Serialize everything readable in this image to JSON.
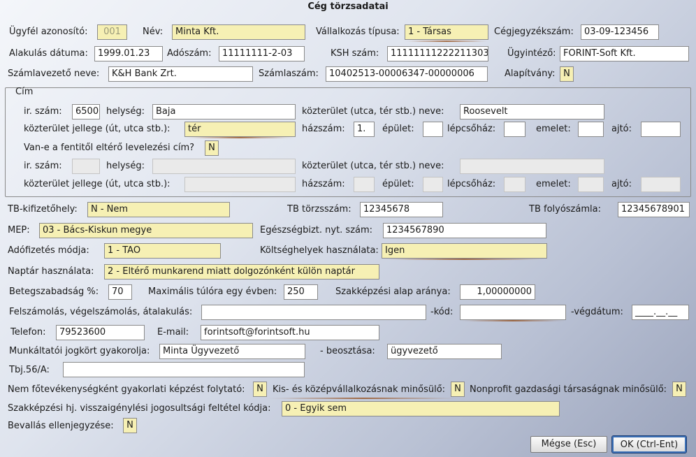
{
  "window": {
    "title": "Cég törzsadatai"
  },
  "labels": {
    "ugyfel_azonosito": "Ügyfél azonosító:",
    "nev": "Név:",
    "vallalkozas_tipusa": "Vállalkozás típusa:",
    "cegjegyzekszam": "Cégjegyzékszám:",
    "alakulas_datuma": "Alakulás dátuma:",
    "adoszam": "Adószám:",
    "ksh_szam": "KSH szám:",
    "ugyintezo": "Ügyintéző:",
    "szamlavezeto_neve": "Számlavezető neve:",
    "szamlaszam": "Számlaszám:",
    "alapitvany": "Alapítvány:",
    "cim_group": "Cím",
    "ir_szam": "ir. szám:",
    "helyseg": "helység:",
    "kozterulet_neve": "közterület (utca, tér stb.) neve:",
    "kozterulet_jellege": "közterület jellege (út, utca stb.):",
    "hazszam": "házszám:",
    "epulet": "épület:",
    "lepcsohaz": "lépcsőház:",
    "emelet": "emelet:",
    "ajto": "ajtó:",
    "elterő_levelezesi": "Van-e a fentitől eltérő levelezési cím?",
    "tb_kifizetohely": "TB-kifizetőhely:",
    "tb_torzsszam": "TB törzsszám:",
    "tb_folyoszamla": "TB folyószámla:",
    "mep": "MEP:",
    "egeszsegbizt": "Egészségbizt. nyt. szám:",
    "adofizetes_modja": "Adófizetés módja:",
    "koltseghelyek": "Költséghelyek használata:",
    "naptar": "Naptár használata:",
    "betegszabadsag": "Betegszabadság %:",
    "max_tulora": "Maximális túlóra egy évben:",
    "szakkepzesi_arany": "Szakképzési alap aránya:",
    "felszamolas": "Felszámolás, végelszámolás, átalakulás:",
    "kod": "-kód:",
    "vegdatum": "-végdátum:",
    "telefon": "Telefon:",
    "email": "E-mail:",
    "munkaltatoi": "Munkáltatói jogkört gyakorolja:",
    "beosztasa": "- beosztása:",
    "tbj56a": "Tbj.56/A:",
    "nem_fotev": "Nem főtevékenységként gyakorlati képzést folytató:",
    "kis_kozep": "Kis- és középvállalkozásnak minősülő:",
    "nonprofit": "Nonprofit gazdasági társaságnak minősülő:",
    "szakkepzesi_kod": "Szakképzési hj. visszaigénylési jogosultsági feltétel kódja:",
    "bevallas": "Bevallás ellenjegyzése:"
  },
  "values": {
    "ugyfel_azonosito": "001",
    "nev": "Minta Kft.",
    "vallalkozas_tipusa": "1 - Társas",
    "cegjegyzekszam": "03-09-123456",
    "alakulas_datuma": "1999.01.23",
    "adoszam": "11111111-2-03",
    "ksh_szam": "11111111222211303",
    "ugyintezo": "FORINT-Soft Kft.",
    "szamlavezeto_neve": "K&H Bank Zrt.",
    "szamlaszam": "10402513-00006347-00000006",
    "alapitvany": "N",
    "ir_szam": "6500",
    "helyseg": "Baja",
    "kozterulet_neve": "Roosevelt",
    "kozterulet_jellege": "tér",
    "hazszam": "1.",
    "epulet": "",
    "lepcsohaz": "",
    "emelet": "",
    "ajto": "",
    "elterő_levelezesi": "N",
    "tb_kifizetohely": "N - Nem",
    "tb_torzsszam": "12345678",
    "tb_folyoszamla": "12345678901",
    "mep": "03 - Bács-Kiskun megye",
    "egeszsegbizt": "1234567890",
    "adofizetes_modja": "1 - TAO",
    "koltseghelyek": "Igen",
    "naptar": "2 - Eltérő munkarend miatt dolgozónként külön naptár",
    "betegszabadsag": "70",
    "max_tulora": "250",
    "szakkepzesi_arany": "1,00000000",
    "felszamolas": "",
    "kod": "",
    "vegdatum": "____.__.__",
    "telefon": "79523600",
    "email": "forintsoft@forintsoft.hu",
    "munkaltatoi": "Minta Ügyvezető",
    "beosztasa": "ügyvezető",
    "tbj56a": "",
    "nem_fotev": "N",
    "kis_kozep": "N",
    "nonprofit": "N",
    "szakkepzesi_kod": "0 - Egyik sem",
    "bevallas": "N"
  },
  "buttons": {
    "cancel": "Mégse (Esc)",
    "ok": "OK (Ctrl-Ent)"
  }
}
